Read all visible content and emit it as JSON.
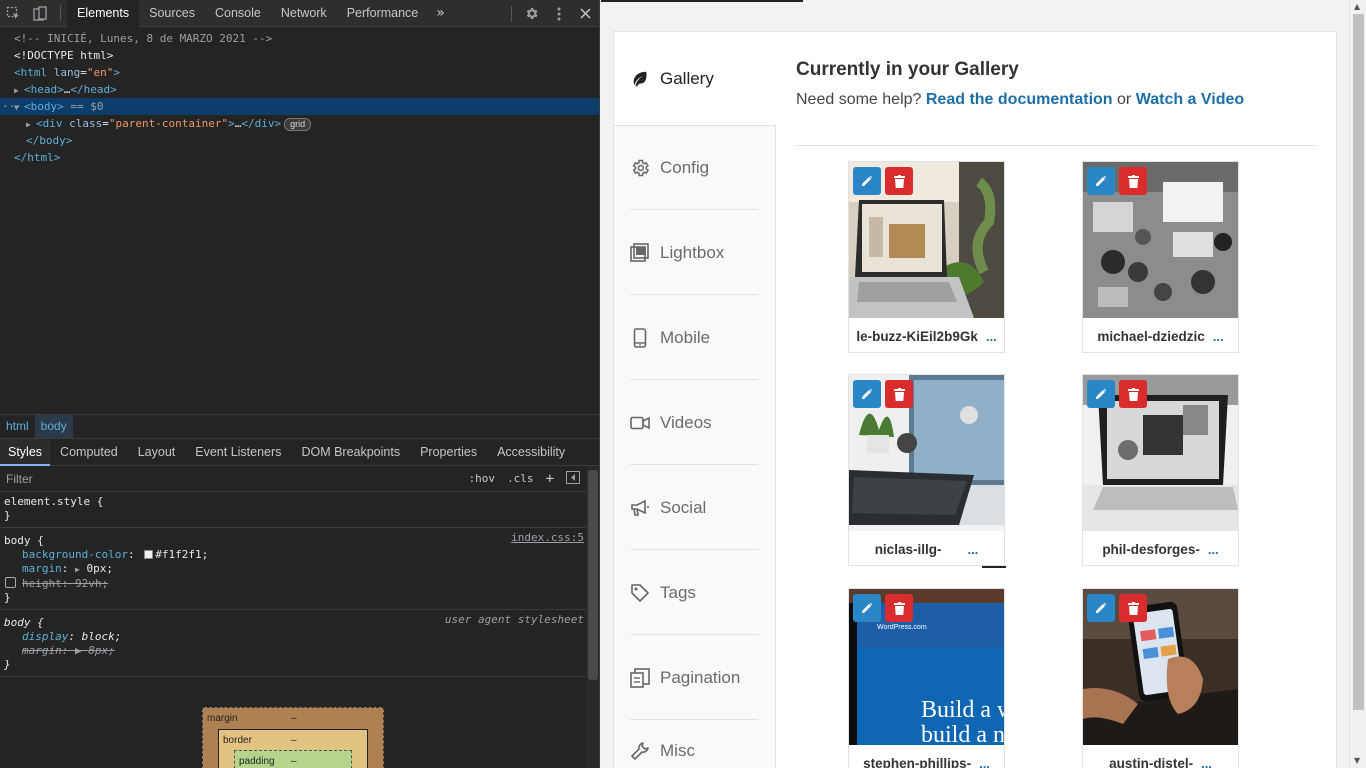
{
  "devtools": {
    "tabs": [
      "Elements",
      "Sources",
      "Console",
      "Network",
      "Performance"
    ],
    "dom": {
      "comment": "<!-- INICIÉ, Lunes, 8 de MARZO 2021 -->",
      "doctype": "<!DOCTYPE html>",
      "html_open_tag": "html",
      "html_lang_attr": "lang",
      "html_lang_val": "\"en\"",
      "head": "head",
      "body": "body",
      "body_suffix": "== $0",
      "div_tag": "div",
      "div_attr": "class",
      "div_val": "\"parent-container\"",
      "grid_badge": "grid",
      "body_close": "</body>",
      "html_close": "</html>"
    },
    "breadcrumbs": [
      "html",
      "body"
    ],
    "style_tabs": [
      "Styles",
      "Computed",
      "Layout",
      "Event Listeners",
      "DOM Breakpoints",
      "Properties",
      "Accessibility"
    ],
    "filter_placeholder": "Filter",
    "filter_buttons": [
      ":hov",
      ".cls",
      "+"
    ],
    "rules": {
      "element_style": "element.style {",
      "close": "}",
      "body_selector": "body {",
      "body_source": "index.css:5",
      "bg_name": "background-color",
      "bg_val": "#f1f2f1;",
      "margin_name": "margin",
      "margin_val": "0px;",
      "height_name": "height",
      "height_val": "92vh;",
      "ua_selector": "body {",
      "ua_source": "user agent stylesheet",
      "display_name": "display",
      "display_val": "block;",
      "ua_margin_name": "margin",
      "ua_margin_val": "8px;"
    },
    "boxmodel": {
      "margin": "margin",
      "border": "border",
      "padding": "padding",
      "dash": "–"
    }
  },
  "page": {
    "sidebar": [
      {
        "label": "Gallery",
        "icon": "leaf-icon"
      },
      {
        "label": "Config",
        "icon": "gear-icon"
      },
      {
        "label": "Lightbox",
        "icon": "lightbox-icon"
      },
      {
        "label": "Mobile",
        "icon": "mobile-icon"
      },
      {
        "label": "Videos",
        "icon": "video-icon"
      },
      {
        "label": "Social",
        "icon": "megaphone-icon"
      },
      {
        "label": "Tags",
        "icon": "tag-icon"
      },
      {
        "label": "Pagination",
        "icon": "pagination-icon"
      },
      {
        "label": "Misc",
        "icon": "wrench-icon"
      }
    ],
    "title": "Currently in your Gallery",
    "help_prefix": "Need some help?",
    "help_link1": "Read the documentation",
    "help_or": "or",
    "help_link2": "Watch a Video",
    "tiles": [
      {
        "caption": "le-buzz-KiEil2b9Gk",
        "dots": "..."
      },
      {
        "caption": "michael-dziedzic",
        "dots": "..."
      },
      {
        "caption": "niclas-illg-",
        "dots": "..."
      },
      {
        "caption": "phil-desforges-",
        "dots": "..."
      },
      {
        "caption": "stephen-phillips-",
        "dots": "..."
      },
      {
        "caption": "austin-distel-",
        "dots": "..."
      }
    ],
    "tile_images_text": {
      "wp_line1": "Build a w",
      "wp_line2": "build a n",
      "wp_brand": "WordPress.com"
    },
    "colors": {
      "accent": "#1e6fa8",
      "edit": "#2a86c6",
      "delete": "#d92c2c"
    }
  }
}
